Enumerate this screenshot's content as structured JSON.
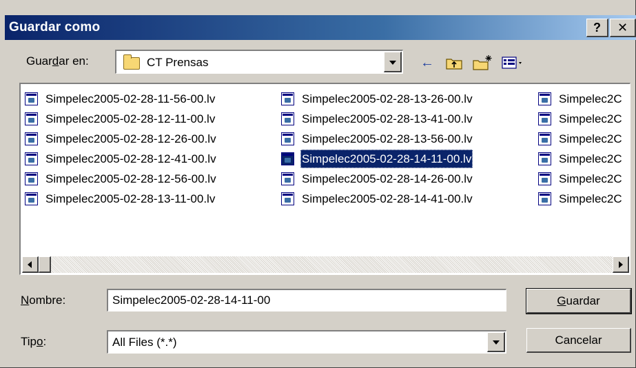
{
  "window": {
    "title": "Guardar como",
    "help_label": "?",
    "close_label": "✕"
  },
  "save_in": {
    "label_pre": "Guar",
    "label_key": "d",
    "label_post": "ar en:",
    "selected": "CT Prensas"
  },
  "toolbar": {
    "back_icon": "←",
    "up_folder_icon": "folder-up-icon",
    "new_folder_icon": "new-folder-icon",
    "view_menu_icon": "view-menu-icon"
  },
  "files": {
    "column_1": [
      "Simpelec2005-02-28-11-56-00.lv",
      "Simpelec2005-02-28-12-11-00.lv",
      "Simpelec2005-02-28-12-26-00.lv",
      "Simpelec2005-02-28-12-41-00.lv",
      "Simpelec2005-02-28-12-56-00.lv",
      "Simpelec2005-02-28-13-11-00.lv"
    ],
    "column_2": [
      "Simpelec2005-02-28-13-26-00.lv",
      "Simpelec2005-02-28-13-41-00.lv",
      "Simpelec2005-02-28-13-56-00.lv",
      "Simpelec2005-02-28-14-11-00.lv",
      "Simpelec2005-02-28-14-26-00.lv",
      "Simpelec2005-02-28-14-41-00.lv"
    ],
    "column_3": [
      "Simpelec2C",
      "Simpelec2C",
      "Simpelec2C",
      "Simpelec2C",
      "Simpelec2C",
      "Simpelec2C"
    ],
    "selected_index": "column_2.3"
  },
  "filename": {
    "label_key": "N",
    "label_post": "ombre:",
    "value": "Simpelec2005-02-28-14-11-00"
  },
  "filetype": {
    "label_pre": "Tip",
    "label_key": "o",
    "label_post": ":",
    "selected": "All Files (*.*)"
  },
  "buttons": {
    "save_key": "G",
    "save_post": "uardar",
    "cancel": "Cancelar"
  },
  "colors": {
    "titlebar": "#0a246a",
    "face": "#d4d0c8",
    "selection": "#0a246a"
  }
}
